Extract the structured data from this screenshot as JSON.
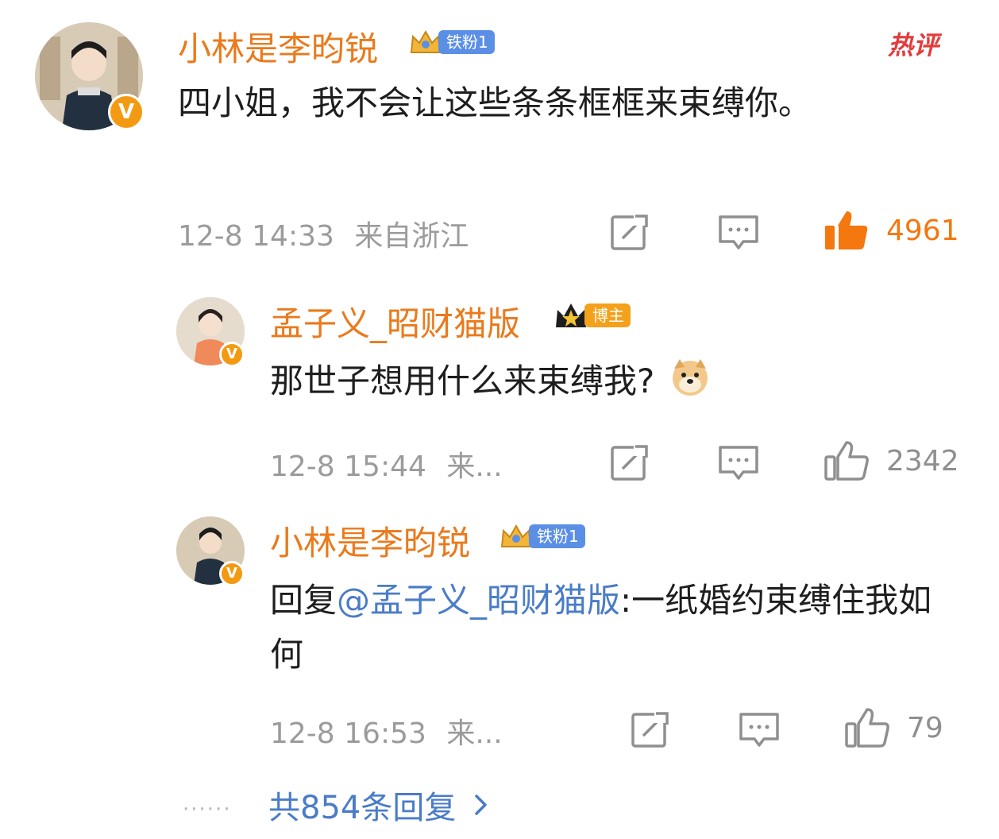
{
  "hot_label": "热评",
  "comment": {
    "author": "小林是李昀锐",
    "badge": "铁粉1",
    "text": "四小姐，我不会让这些条条框框来束缚你。",
    "time": "12-8 14:33",
    "location": "来自浙江",
    "likes": "4961"
  },
  "replies": [
    {
      "author": "孟子义_昭财猫版",
      "badge": "博主",
      "text": "那世子想用什么来束缚我?",
      "emoji": "doge",
      "time": "12-8 15:44",
      "location": "来...",
      "likes": "2342"
    },
    {
      "author": "小林是李昀锐",
      "badge": "铁粉1",
      "reply_prefix": "回复",
      "mention": "@孟子义_昭财猫版",
      "text": ":一纸婚约束缚住我如何",
      "time": "12-8 16:53",
      "location": "来...",
      "likes": "79"
    }
  ],
  "more_replies": "共854条回复",
  "more_dots": "······",
  "colors": {
    "name": "#ea7a1c",
    "link": "#4a7cc7",
    "like_active": "#f4770f",
    "hot": "#e23c3c"
  },
  "icons": [
    "repost-icon",
    "comment-icon",
    "like-icon",
    "chevron-right-icon",
    "verified-icon",
    "crown-icon"
  ]
}
